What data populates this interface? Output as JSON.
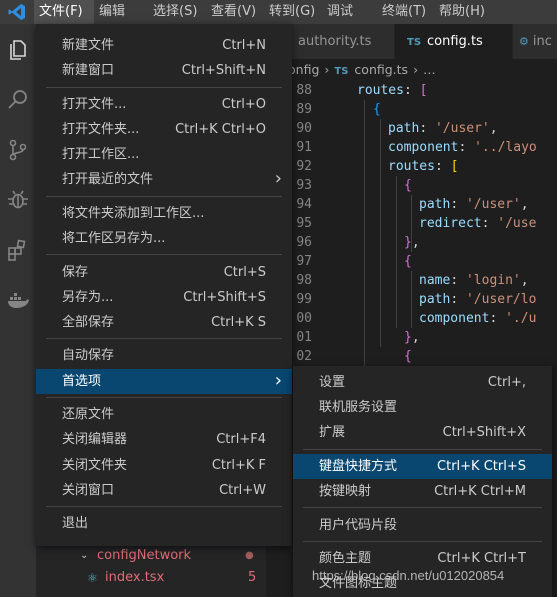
{
  "menubar": {
    "items": [
      "文件(F)",
      "编辑(E)",
      "选择(S)",
      "查看(V)",
      "转到(G)",
      "调试(D)",
      "终端(T)",
      "帮助(H)"
    ],
    "active_index": 0
  },
  "activitybar": {
    "icons": [
      "files-icon",
      "search-icon",
      "source-control-icon",
      "debug-icon",
      "extensions-icon",
      "docker-icon"
    ]
  },
  "sidebar": {
    "tree": [
      {
        "label": "configNetwork",
        "badge": "●"
      },
      {
        "label": "index.tsx",
        "badge": "5"
      }
    ]
  },
  "editor": {
    "tabs": [
      {
        "label": "authority.ts",
        "badge": ""
      },
      {
        "label": "config.ts",
        "badge": "TS"
      },
      {
        "label": "inc",
        "badge": ""
      }
    ],
    "breadcrumb": {
      "part1": "onfig",
      "part2": "config.ts",
      "part3": "…",
      "badge": "TS"
    },
    "lines": [
      {
        "num": "88",
        "tokens": [
          [
            "k",
            "routes"
          ],
          [
            "p",
            ": "
          ],
          [
            "b2",
            "["
          ]
        ]
      },
      {
        "num": "89",
        "tokens": [
          [
            "b3",
            "{"
          ]
        ]
      },
      {
        "num": "90",
        "tokens": [
          [
            "k",
            "path"
          ],
          [
            "p",
            ": "
          ],
          [
            "s",
            "'/user'"
          ],
          [
            "p",
            ","
          ]
        ]
      },
      {
        "num": "91",
        "tokens": [
          [
            "k",
            "component"
          ],
          [
            "p",
            ": "
          ],
          [
            "s",
            "'../layo"
          ]
        ]
      },
      {
        "num": "92",
        "tokens": [
          [
            "k",
            "routes"
          ],
          [
            "p",
            ": "
          ],
          [
            "b1",
            "["
          ]
        ]
      },
      {
        "num": "93",
        "tokens": [
          [
            "b2",
            "{"
          ]
        ]
      },
      {
        "num": "94",
        "tokens": [
          [
            "k",
            "path"
          ],
          [
            "p",
            ": "
          ],
          [
            "s",
            "'/user'"
          ],
          [
            "p",
            ","
          ]
        ]
      },
      {
        "num": "95",
        "tokens": [
          [
            "k",
            "redirect"
          ],
          [
            "p",
            ": "
          ],
          [
            "s",
            "'/use"
          ]
        ]
      },
      {
        "num": "96",
        "tokens": [
          [
            "b2",
            "}"
          ],
          [
            "p",
            ","
          ]
        ]
      },
      {
        "num": "97",
        "tokens": [
          [
            "b2",
            "{"
          ]
        ]
      },
      {
        "num": "98",
        "tokens": [
          [
            "k",
            "name"
          ],
          [
            "p",
            ": "
          ],
          [
            "s",
            "'login'"
          ],
          [
            "p",
            ","
          ]
        ]
      },
      {
        "num": "99",
        "tokens": [
          [
            "k",
            "path"
          ],
          [
            "p",
            ": "
          ],
          [
            "s",
            "'/user/lo"
          ]
        ]
      },
      {
        "num": "00",
        "tokens": [
          [
            "k",
            "component"
          ],
          [
            "p",
            ": "
          ],
          [
            "s",
            "'./u"
          ]
        ]
      },
      {
        "num": "01",
        "tokens": [
          [
            "b2",
            "}"
          ],
          [
            "p",
            ","
          ]
        ]
      },
      {
        "num": "02",
        "tokens": [
          [
            "b2",
            "{"
          ]
        ]
      }
    ]
  },
  "file_menu": {
    "groups": [
      [
        {
          "label": "新建文件",
          "key": "Ctrl+N"
        },
        {
          "label": "新建窗口",
          "key": "Ctrl+Shift+N"
        }
      ],
      [
        {
          "label": "打开文件...",
          "key": "Ctrl+O"
        },
        {
          "label": "打开文件夹...",
          "key": "Ctrl+K Ctrl+O"
        },
        {
          "label": "打开工作区...",
          "key": ""
        },
        {
          "label": "打开最近的文件",
          "key": "",
          "submenu": true
        }
      ],
      [
        {
          "label": "将文件夹添加到工作区...",
          "key": ""
        },
        {
          "label": "将工作区另存为...",
          "key": ""
        }
      ],
      [
        {
          "label": "保存",
          "key": "Ctrl+S"
        },
        {
          "label": "另存为...",
          "key": "Ctrl+Shift+S"
        },
        {
          "label": "全部保存",
          "key": "Ctrl+K S"
        }
      ],
      [
        {
          "label": "自动保存",
          "key": ""
        },
        {
          "label": "首选项",
          "key": "",
          "submenu": true,
          "selected": true
        }
      ],
      [
        {
          "label": "还原文件",
          "key": ""
        },
        {
          "label": "关闭编辑器",
          "key": "Ctrl+F4"
        },
        {
          "label": "关闭文件夹",
          "key": "Ctrl+K F"
        },
        {
          "label": "关闭窗口",
          "key": "Ctrl+W"
        }
      ],
      [
        {
          "label": "退出",
          "key": ""
        }
      ]
    ]
  },
  "prefs_menu": {
    "groups": [
      [
        {
          "label": "设置",
          "key": "Ctrl+,"
        },
        {
          "label": "联机服务设置",
          "key": ""
        },
        {
          "label": "扩展",
          "key": "Ctrl+Shift+X"
        }
      ],
      [
        {
          "label": "键盘快捷方式",
          "key": "Ctrl+K Ctrl+S",
          "selected": true
        },
        {
          "label": "按键映射",
          "key": "Ctrl+K Ctrl+M"
        }
      ],
      [
        {
          "label": "用户代码片段",
          "key": ""
        }
      ],
      [
        {
          "label": "颜色主题",
          "key": "Ctrl+K Ctrl+T"
        },
        {
          "label": "文件图标主题",
          "key": ""
        }
      ]
    ]
  },
  "watermark": "https://blog.csdn.net/u012020854",
  "colors": {
    "accent": "#094771",
    "menubar": "#3c3c3c",
    "menu_bg": "#252526",
    "vscode_blue": "#2b8fe3"
  }
}
